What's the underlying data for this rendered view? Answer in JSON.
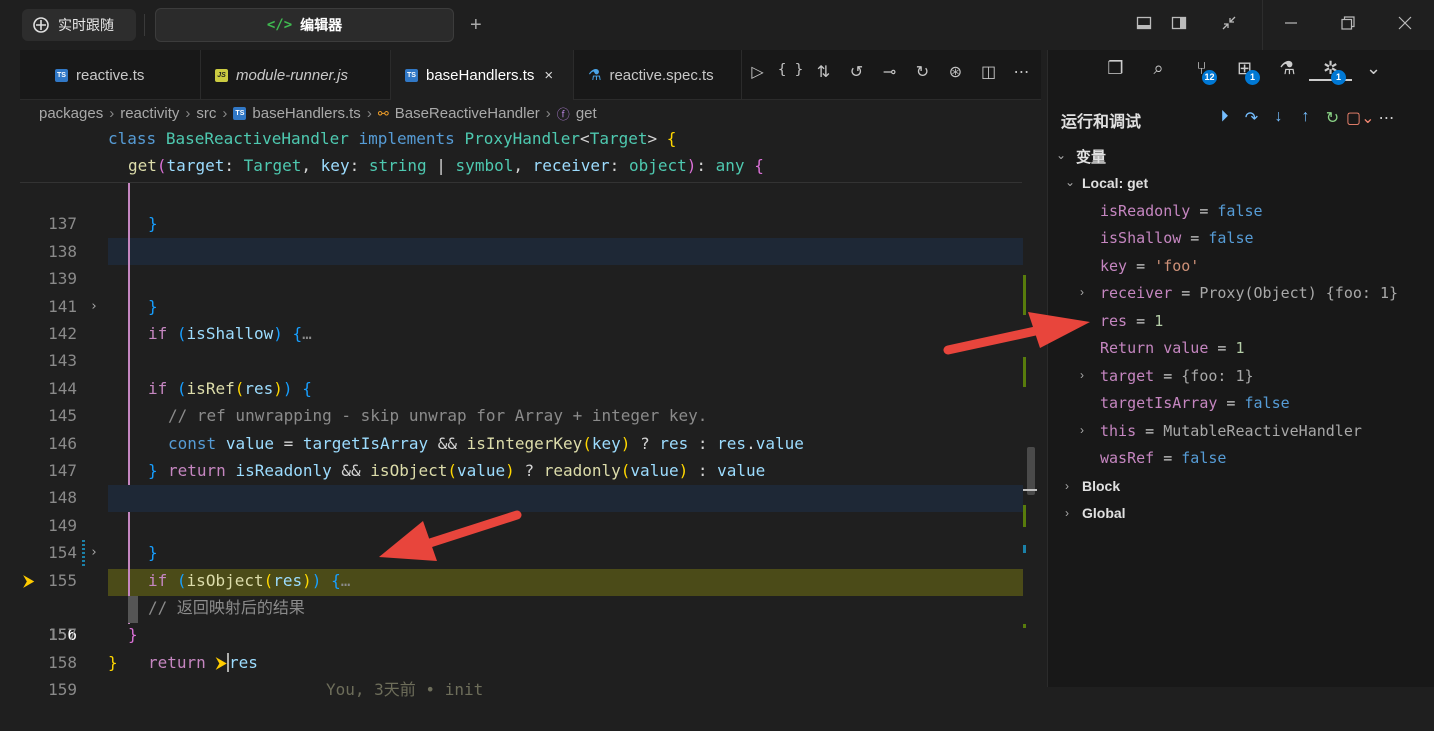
{
  "titlebar": {
    "live_label": "实时跟随",
    "editor_label": "编辑器",
    "plus": "+"
  },
  "tabs": [
    {
      "label": "reactive.ts",
      "kind": "ts"
    },
    {
      "label": "module-runner.js",
      "kind": "js"
    },
    {
      "label": "baseHandlers.ts",
      "kind": "ts",
      "active": true,
      "close": "×"
    },
    {
      "label": "reactive.spec.ts",
      "kind": "test"
    }
  ],
  "breadcrumb": {
    "items": [
      "packages",
      "reactivity",
      "src",
      "baseHandlers.ts",
      "BaseReactiveHandler",
      "get"
    ]
  },
  "sticky": {
    "line1": {
      "kw": "class",
      "name": "BaseReactiveHandler",
      "kw2": "implements",
      "iface": "ProxyHandler",
      "lt": "<",
      "tparam": "Target",
      "gt": ">",
      "brace": "{"
    },
    "line2": {
      "fn": "get",
      "open": "(",
      "p1": "target",
      "c1": ": ",
      "t1": "Target",
      "comma1": ", ",
      "p2": "key",
      "c2": ": ",
      "t2": "string",
      "pipe": " | ",
      "t3": "symbol",
      "comma2": ", ",
      "p3": "receiver",
      "c3": ": ",
      "t4": "object",
      "close": ")",
      "c4": ": ",
      "t5": "any",
      "brace": "{"
    }
  },
  "lines": [
    {
      "num": "137",
      "code": "}"
    },
    {
      "num": "138",
      "code": ""
    },
    {
      "num": "139",
      "code": "if (isShallow) {…"
    },
    {
      "num": "141",
      "code": "}"
    },
    {
      "num": "142",
      "code": ""
    },
    {
      "num": "143",
      "code": "if (isRef(res)) {"
    },
    {
      "num": "144",
      "code": "// ref unwrapping - skip unwrap for Array + integer key."
    },
    {
      "num": "145",
      "code": "const value = targetIsArray && isIntegerKey(key) ? res : res.value"
    },
    {
      "num": "146",
      "code": "return isReadonly && isObject(value) ? readonly(value) : value"
    },
    {
      "num": "147",
      "code": "}"
    },
    {
      "num": "148",
      "code": ""
    },
    {
      "num": "149",
      "code": "if (isObject(res)) {…"
    },
    {
      "num": "154",
      "code": "}"
    },
    {
      "num": "155",
      "code": "// 返回映射后的结果"
    },
    {
      "num": "156",
      "code": "return res"
    },
    {
      "num": "157",
      "code": "}"
    },
    {
      "num": "158",
      "code": "}"
    },
    {
      "num": "159",
      "code": ""
    }
  ],
  "code_tokens": {
    "if": "if",
    "isShallow": "isShallow",
    "isRef": "isRef",
    "res": "res",
    "comment144": "// ref unwrapping - skip unwrap for Array + integer key.",
    "const": "const",
    "value": "value",
    "eq": " = ",
    "targetIsArray": "targetIsArray",
    "and": " && ",
    "isIntegerKey": "isIntegerKey",
    "key": "key",
    "q": " ? ",
    "colon": " : ",
    "dotvalue": ".value",
    "return": "return",
    "isReadonly": "isReadonly",
    "isObject": "isObject",
    "readonly": "readonly",
    "ellipsis": "…",
    "comment155": "// 返回映射后的结果",
    "blame": "You, 3天前 • init"
  },
  "debug": {
    "title": "运行和调试",
    "variables_label": "变量",
    "local_label": "Local: get",
    "badges": {
      "scm": "12",
      "ext": "1",
      "debug": "1"
    },
    "vars": [
      {
        "name": "isReadonly",
        "value": "false",
        "type": "bool"
      },
      {
        "name": "isShallow",
        "value": "false",
        "type": "bool"
      },
      {
        "name": "key",
        "value": "'foo'",
        "type": "str"
      },
      {
        "name": "receiver",
        "value": "Proxy(Object) {foo: 1}",
        "type": "obj",
        "expandable": true
      },
      {
        "name": "res",
        "value": "1",
        "type": "num"
      },
      {
        "name": "Return value",
        "value": "1",
        "type": "num"
      },
      {
        "name": "target",
        "value": "{foo: 1}",
        "type": "obj",
        "expandable": true
      },
      {
        "name": "targetIsArray",
        "value": "false",
        "type": "bool"
      },
      {
        "name": "this",
        "value": "MutableReactiveHandler",
        "type": "obj",
        "expandable": true
      },
      {
        "name": "wasRef",
        "value": "false",
        "type": "bool"
      }
    ],
    "block_label": "Block",
    "global_label": "Global"
  },
  "colors": {
    "accent": "#0078d4",
    "arrow": "#e8453c",
    "current_line": "#4b4b18",
    "breakpoint": "#ffcc00"
  }
}
